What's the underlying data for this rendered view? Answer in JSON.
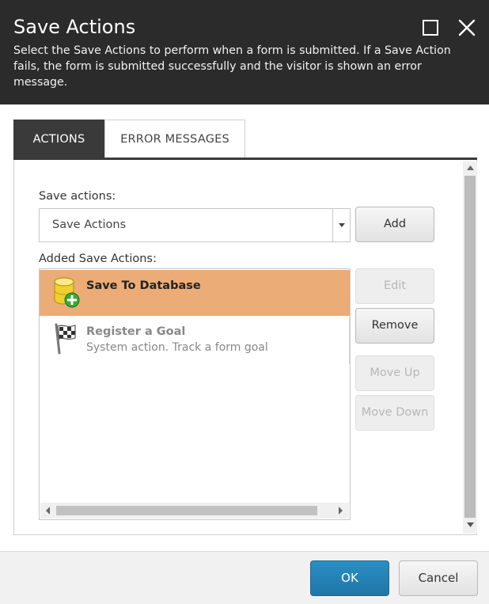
{
  "dialog": {
    "title": "Save Actions",
    "description": "Select the Save Actions to perform when a form is submitted. If a Save Action fails, the form is submitted successfully and the visitor is shown an error message.",
    "maximize_icon": "maximize-icon",
    "close_icon": "close-icon"
  },
  "tabs": [
    {
      "label": "ACTIONS",
      "active": true
    },
    {
      "label": "ERROR MESSAGES",
      "active": false
    }
  ],
  "save_actions": {
    "label": "Save actions:",
    "selected_value": "Save Actions",
    "add_label": "Add"
  },
  "added_actions": {
    "label": "Added Save Actions:",
    "items": [
      {
        "name": "Save To Database",
        "description": "",
        "icon": "database-add-icon",
        "selected": true
      },
      {
        "name": "Register a Goal",
        "description": "System action. Track a form goal",
        "icon": "checkered-flag-icon",
        "selected": false
      }
    ]
  },
  "side_buttons": {
    "edit": "Edit",
    "remove": "Remove",
    "move_up": "Move Up",
    "move_down": "Move Down"
  },
  "footer": {
    "ok": "OK",
    "cancel": "Cancel"
  },
  "colors": {
    "header_bg": "#2b2b2b",
    "selected_row": "#ebac77",
    "ok_button": "#1f75a8"
  }
}
